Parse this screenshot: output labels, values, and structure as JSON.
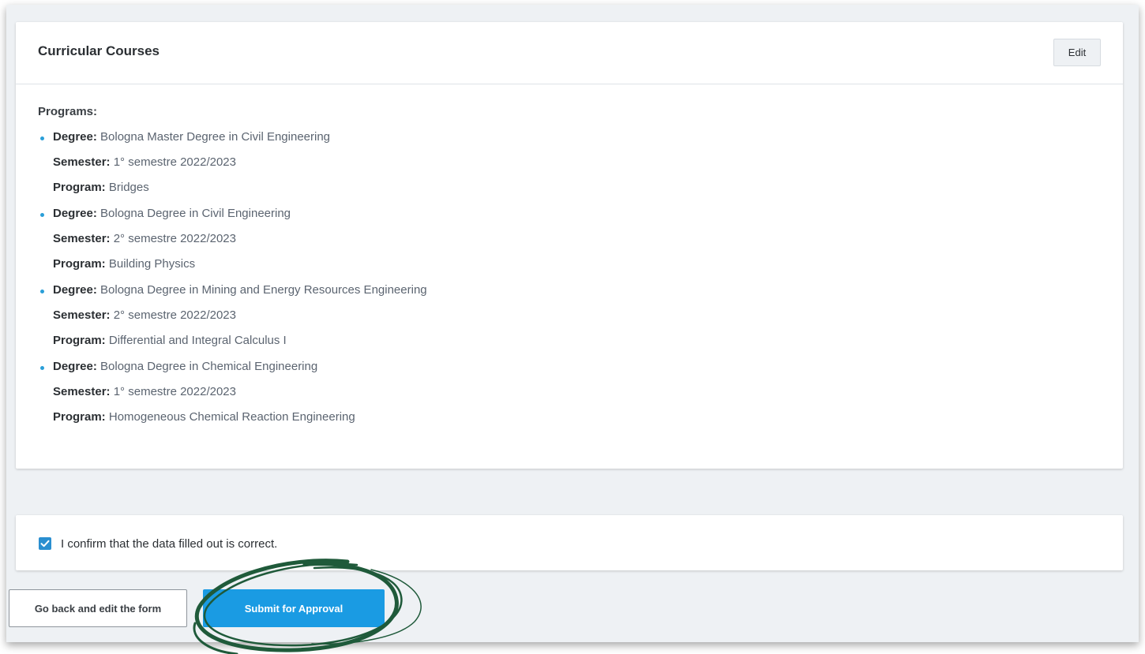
{
  "section": {
    "title": "Curricular Courses",
    "edit_label": "Edit",
    "programs_label": "Programs:"
  },
  "programs": [
    {
      "degree_key": "Degree:",
      "degree": "Bologna Master Degree in Civil Engineering",
      "semester_key": "Semester:",
      "semester": "1° semestre 2022/2023",
      "program_key": "Program:",
      "program": "Bridges"
    },
    {
      "degree_key": "Degree:",
      "degree": "Bologna Degree in Civil Engineering",
      "semester_key": "Semester:",
      "semester": "2° semestre 2022/2023",
      "program_key": "Program:",
      "program": "Building Physics"
    },
    {
      "degree_key": "Degree:",
      "degree": "Bologna Degree in Mining and Energy Resources Engineering",
      "semester_key": "Semester:",
      "semester": "2° semestre 2022/2023",
      "program_key": "Program:",
      "program": "Differential and Integral Calculus I"
    },
    {
      "degree_key": "Degree:",
      "degree": "Bologna Degree in Chemical Engineering",
      "semester_key": "Semester:",
      "semester": "1° semestre 2022/2023",
      "program_key": "Program:",
      "program": "Homogeneous Chemical Reaction Engineering"
    }
  ],
  "confirmation": {
    "label": "I confirm that the data filled out is correct.",
    "checked": true
  },
  "actions": {
    "back_label": "Go back and edit the form",
    "submit_label": "Submit for Approval"
  },
  "colors": {
    "accent": "#1a9be3",
    "annotation": "#1f5a3a"
  }
}
